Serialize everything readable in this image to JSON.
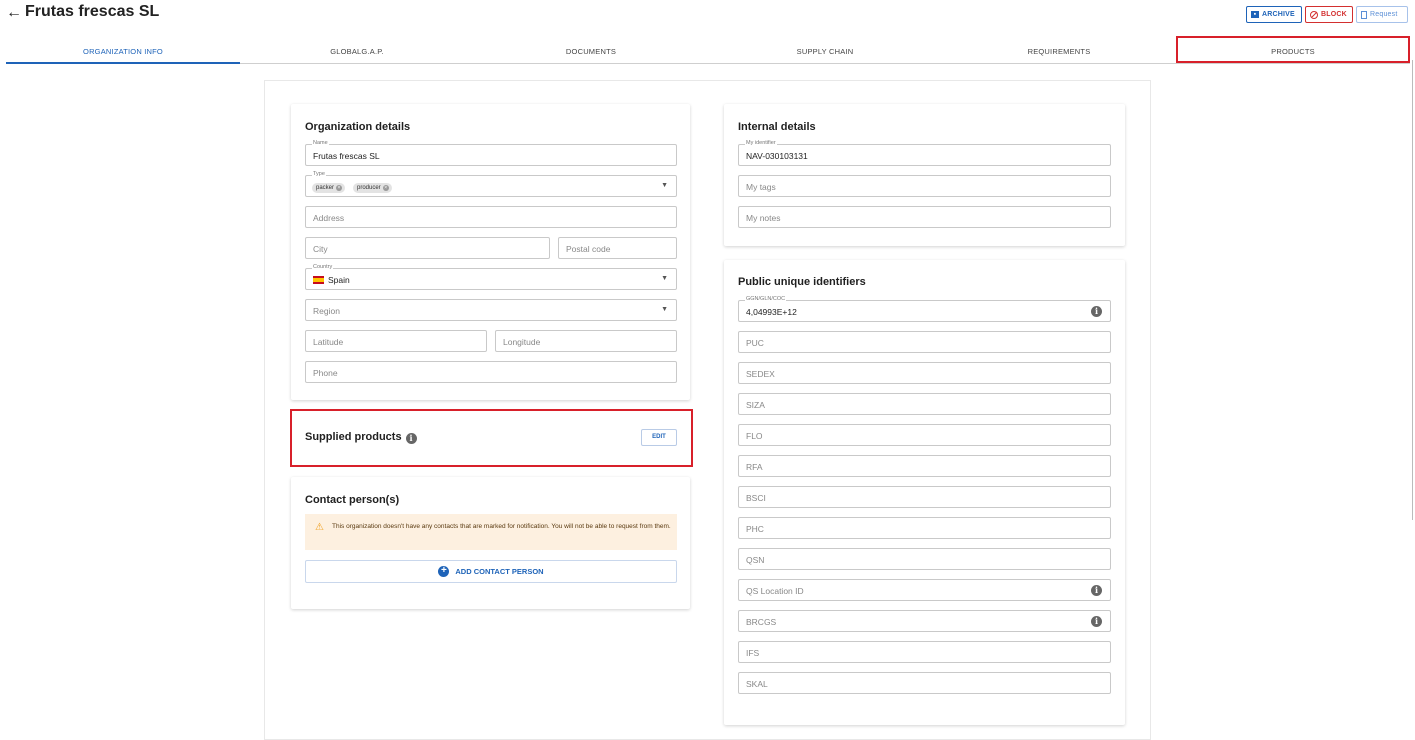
{
  "header": {
    "back_icon": "arrow-left-icon",
    "title": "Frutas frescas SL",
    "archive_label": "ARCHIVE",
    "block_label": "BLOCK",
    "request_label": "Request"
  },
  "tabs": [
    {
      "label": "ORGANIZATION INFO",
      "active": true
    },
    {
      "label": "GLOBALG.A.P.",
      "active": false
    },
    {
      "label": "DOCUMENTS",
      "active": false
    },
    {
      "label": "SUPPLY CHAIN",
      "active": false
    },
    {
      "label": "REQUIREMENTS",
      "active": false
    },
    {
      "label": "PRODUCTS",
      "active": false
    }
  ],
  "org_details": {
    "title": "Organization details",
    "name_label": "Name",
    "name_value": "Frutas frescas SL",
    "type_label": "Type",
    "type_chips": [
      "packer",
      "producer"
    ],
    "address_placeholder": "Address",
    "city_placeholder": "City",
    "postal_placeholder": "Postal code",
    "country_label": "Country",
    "country_value": "Spain",
    "region_placeholder": "Region",
    "latitude_placeholder": "Latitude",
    "longitude_placeholder": "Longitude",
    "phone_placeholder": "Phone"
  },
  "supplied_products": {
    "title": "Supplied products",
    "edit_label": "EDIT"
  },
  "contacts": {
    "title": "Contact person(s)",
    "warning": "This organization doesn't have any contacts that are marked for notification. You will not be able to request from them.",
    "add_label": "ADD CONTACT PERSON"
  },
  "internal": {
    "title": "Internal details",
    "identifier_label": "My identifier",
    "identifier_value": "NAV-030103131",
    "tags_placeholder": "My tags",
    "notes_placeholder": "My notes"
  },
  "public_ids": {
    "title": "Public unique identifiers",
    "ggn_label": "GGN/GLN/COC",
    "ggn_value": "4,04993E+12",
    "fields": [
      "PUC",
      "SEDEX",
      "SIZA",
      "FLO",
      "RFA",
      "BSCI",
      "PHC",
      "QSN",
      "QS Location ID",
      "BRCGS",
      "IFS",
      "SKAL"
    ]
  },
  "colors": {
    "accent": "#1e63b8",
    "danger": "#d32f2f",
    "highlight": "#d8202a",
    "warning_bg": "#fdf0e0"
  }
}
